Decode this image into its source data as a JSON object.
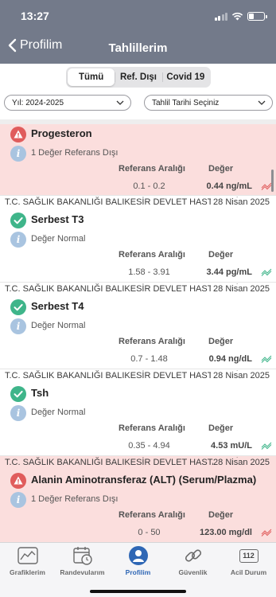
{
  "status_bar": {
    "time": "13:27",
    "battery_level": 0.35
  },
  "nav": {
    "back_label": "Profilim",
    "title": "Tahlillerim"
  },
  "filters": {
    "segments": [
      "Tümü",
      "Ref. Dışı",
      "Covid 19"
    ],
    "active_segment": "Tümü",
    "year_select": "Yıl: 2024-2025",
    "date_select": "Tahlil Tarihi Seçiniz"
  },
  "tests": [
    {
      "institution": "",
      "date": "",
      "name": "Progesteron",
      "status": "abnormal",
      "note": "1 Değer Referans Dışı",
      "ref_header": "Referans Aralığı",
      "value_header": "Değer",
      "range": "0.1 - 0.2",
      "value": "0.44 ng/mL"
    },
    {
      "institution": "T.C. SAĞLIK BAKANLIĞI BALIKESİR DEVLET HASTANESİ",
      "date": "28 Nisan 2025",
      "name": "Serbest T3",
      "status": "normal",
      "note": "Değer Normal",
      "ref_header": "Referans Aralığı",
      "value_header": "Değer",
      "range": "1.58 - 3.91",
      "value": "3.44 pg/mL"
    },
    {
      "institution": "T.C. SAĞLIK BAKANLIĞI BALIKESİR DEVLET HASTANESİ",
      "date": "28 Nisan 2025",
      "name": "Serbest T4",
      "status": "normal",
      "note": "Değer Normal",
      "ref_header": "Referans Aralığı",
      "value_header": "Değer",
      "range": "0.7 - 1.48",
      "value": "0.94 ng/dL"
    },
    {
      "institution": "T.C. SAĞLIK BAKANLIĞI BALIKESİR DEVLET HASTANESİ",
      "date": "28 Nisan 2025",
      "name": "Tsh",
      "status": "normal",
      "note": "Değer Normal",
      "ref_header": "Referans Aralığı",
      "value_header": "Değer",
      "range": "0.35 - 4.94",
      "value": "4.53 mU/L"
    },
    {
      "institution": "T.C. SAĞLIK BAKANLIĞI BALIKESİR DEVLET HASTANESİ",
      "date": "28 Nisan 2025",
      "name": "Alanin Aminotransferaz (ALT) (Serum/Plazma)",
      "status": "abnormal",
      "note": "1 Değer Referans Dışı",
      "ref_header": "Referans Aralığı",
      "value_header": "Değer",
      "range": "0 - 50",
      "value": "123.00 mg/dl"
    }
  ],
  "tabbar": {
    "items": [
      {
        "label": "Grafiklerim",
        "icon": "chart-icon"
      },
      {
        "label": "Randevularım",
        "icon": "calendar-clock-icon"
      },
      {
        "label": "Profilim",
        "icon": "person-icon"
      },
      {
        "label": "Güvenlik",
        "icon": "link-icon"
      },
      {
        "label": "Acil Durum",
        "icon": "emergency-112-icon",
        "icon_text": "112"
      }
    ],
    "active": "Profilim"
  },
  "colors": {
    "header_bg": "#737a8a",
    "abnormal_bg": "#fbdedd",
    "warning_red": "#e05c5c",
    "normal_green": "#3fb58a",
    "info_blue": "#a9c4e0",
    "active_tab": "#2f67b5"
  }
}
